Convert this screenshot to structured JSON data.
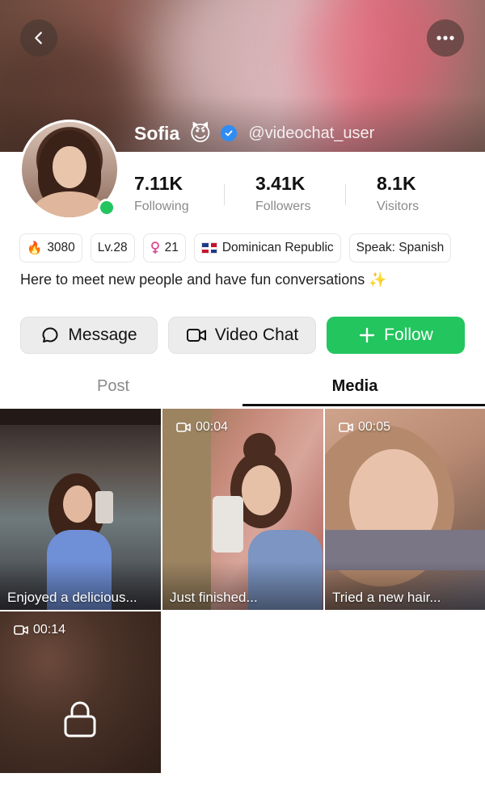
{
  "profile": {
    "name": "Sofia",
    "emoji": "😈",
    "handle": "@videochat_user",
    "bio": "Here to meet new people and have fun conversations ✨"
  },
  "stats": [
    {
      "value": "7.11K",
      "label": "Following"
    },
    {
      "value": "3.41K",
      "label": "Followers"
    },
    {
      "value": "8.1K",
      "label": "Visitors"
    }
  ],
  "tags": {
    "fire": "3080",
    "level": "Lv.28",
    "age": "21",
    "country": "Dominican Republic",
    "speak": "Speak: Spanish"
  },
  "actions": {
    "message": "Message",
    "video_chat": "Video Chat",
    "follow": "Follow"
  },
  "tabs": {
    "post": "Post",
    "media": "Media"
  },
  "media": [
    {
      "caption": "Enjoyed a delicious...",
      "duration": ""
    },
    {
      "caption": "Just finished...",
      "duration": "00:04"
    },
    {
      "caption": "Tried a new hair...",
      "duration": "00:05"
    },
    {
      "caption": "",
      "duration": "00:14",
      "locked": true
    }
  ],
  "colors": {
    "accent": "#22c55e",
    "verified": "#2f8cf5"
  }
}
